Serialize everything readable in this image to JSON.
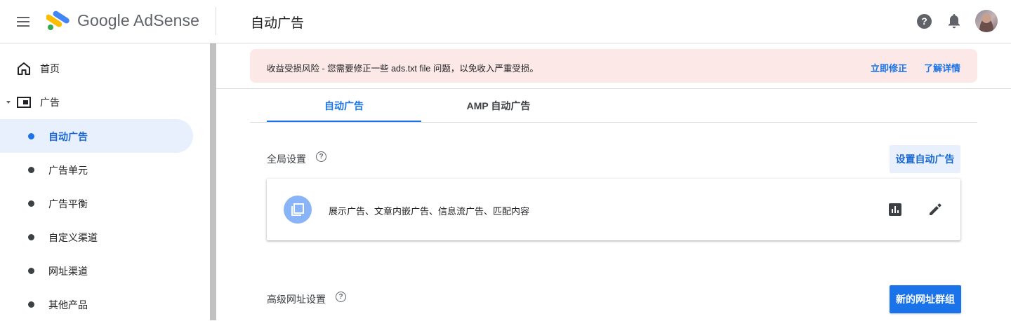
{
  "app": {
    "brand": "Google AdSense",
    "page_title": "自动广告"
  },
  "header": {
    "icons": [
      "menu-icon",
      "help-icon",
      "notifications-icon",
      "avatar"
    ]
  },
  "sidebar": {
    "items": [
      {
        "label": "首页",
        "icon": "home-icon"
      },
      {
        "label": "广告",
        "icon": "ads-icon",
        "expanded": true
      }
    ],
    "sub_items": [
      {
        "label": "自动广告",
        "active": true
      },
      {
        "label": "广告单元"
      },
      {
        "label": "广告平衡"
      },
      {
        "label": "自定义渠道"
      },
      {
        "label": "网址渠道"
      },
      {
        "label": "其他产品"
      }
    ]
  },
  "alert": {
    "text": "收益受损风险 - 您需要修正一些 ads.txt file 问题，以免收入严重受损。",
    "fix_label": "立即修正",
    "learn_label": "了解详情"
  },
  "tabs": [
    {
      "label": "自动广告",
      "active": true
    },
    {
      "label": "AMP 自动广告",
      "active": false
    }
  ],
  "global_settings": {
    "title": "全局设置",
    "setup_button": "设置自动广告",
    "card_text": "展示广告、文章内嵌广告、信息流广告、匹配内容",
    "card_icon": "ad-format-icon",
    "actions": [
      "report-icon",
      "edit-icon"
    ]
  },
  "advanced": {
    "title": "高级网址设置",
    "new_group_button": "新的网址群组"
  },
  "colors": {
    "accent": "#1a73e8",
    "alert_bg": "#fce8e6",
    "active_bg": "#e8f0fe"
  }
}
